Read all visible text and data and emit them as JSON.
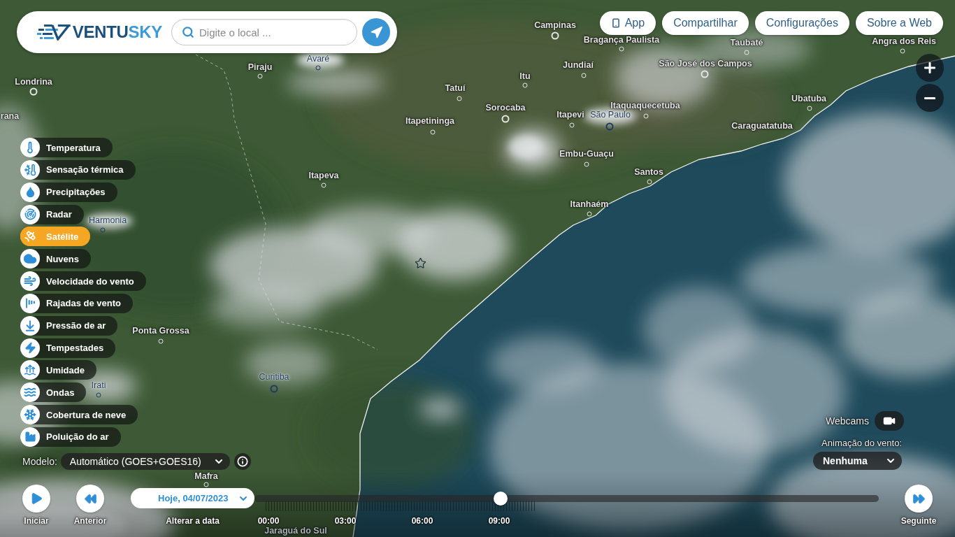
{
  "header": {
    "logo": {
      "text": "VENTU",
      "text_accent": "SKY"
    },
    "search": {
      "placeholder": "Digite o local ..."
    }
  },
  "nav_buttons": [
    {
      "label": "App",
      "kind": "icon"
    },
    {
      "label": "Compartilhar",
      "kind": "text"
    },
    {
      "label": "Configurações",
      "kind": "text"
    },
    {
      "label": "Sobre a Web",
      "kind": "text"
    }
  ],
  "map": {
    "places": [
      {
        "name": "Campinas",
        "color": "#e4e4e4"
      },
      {
        "name": "Bragança Paulista",
        "color": "#e4e4e4"
      },
      {
        "name": "Taubaté",
        "color": "#e4e4e4"
      },
      {
        "name": "Angra dos Reis",
        "color": "#e4e4e4"
      },
      {
        "name": "Avaré",
        "color": "#1f3a5f"
      },
      {
        "name": "Piraju",
        "color": "#e4e4e4"
      },
      {
        "name": "Jundiaí",
        "color": "#e4e4e4"
      },
      {
        "name": "São José dos Campos",
        "color": "#e4e4e4"
      },
      {
        "name": "Itu",
        "color": "#e4e4e4"
      },
      {
        "name": "Londrina",
        "color": "#e4e4e4"
      },
      {
        "name": "Tatuí",
        "color": "#e4e4e4"
      },
      {
        "name": "Ubatuba",
        "color": "#e4e4e4"
      },
      {
        "name": "Sorocaba",
        "color": "#e4e4e4"
      },
      {
        "name": "Itaquaquecetuba",
        "color": "#e4e4e4"
      },
      {
        "name": "rana",
        "color": "#e4e4e4"
      },
      {
        "name": "Itapevi",
        "color": "#e4e4e4"
      },
      {
        "name": "São Paulo",
        "color": "#1f3a5f"
      },
      {
        "name": "Itapetininga",
        "color": "#e4e4e4"
      },
      {
        "name": "Caraguatatuba",
        "color": "#e4e4e4"
      },
      {
        "name": "Embu-Guaçu",
        "color": "#e4e4e4"
      },
      {
        "name": "Santos",
        "color": "#e4e4e4"
      },
      {
        "name": "Itapeva",
        "color": "#e4e4e4"
      },
      {
        "name": "Itanhaém",
        "color": "#e4e4e4"
      },
      {
        "name": "Harmonia",
        "color": "#1f3a5f"
      },
      {
        "name": "Ponta Grossa",
        "color": "#e4e4e4"
      },
      {
        "name": "Curitiba",
        "color": "#1f3a5f"
      },
      {
        "name": "Irati",
        "color": "#1f3a5f"
      },
      {
        "name": "Mafra",
        "color": "#e4e4e4"
      },
      {
        "name": "Jaraguá do Sul",
        "color": "#aeb4ba"
      }
    ]
  },
  "layers": [
    {
      "label": "Temperatura",
      "selected": false
    },
    {
      "label": "Sensação térmica",
      "selected": false
    },
    {
      "label": "Precipitações",
      "selected": false
    },
    {
      "label": "Radar",
      "selected": false
    },
    {
      "label": "Satélite",
      "selected": true
    },
    {
      "label": "Nuvens",
      "selected": false
    },
    {
      "label": "Velocidade do vento",
      "selected": false
    },
    {
      "label": "Rajadas de vento",
      "selected": false
    },
    {
      "label": "Pressão de ar",
      "selected": false
    },
    {
      "label": "Tempestades",
      "selected": false
    },
    {
      "label": "Umidade",
      "selected": false
    },
    {
      "label": "Ondas",
      "selected": false
    },
    {
      "label": "Cobertura de neve",
      "selected": false
    },
    {
      "label": "Poluição do ar",
      "selected": false
    }
  ],
  "model": {
    "label": "Modelo:",
    "value": "Automático (GOES+GOES16)"
  },
  "webcams": {
    "label": "Webcams"
  },
  "wind_animation": {
    "label": "Animação do vento:",
    "value": "Nenhuma"
  },
  "timeline": {
    "controls": [
      {
        "kind": "play",
        "label": "Iniciar"
      },
      {
        "kind": "previous",
        "label": "Anterior"
      }
    ],
    "date": "Hoje, 04/07/2023",
    "date_label": "Alterar a data",
    "level": 0.394,
    "hours": [
      "00:00",
      "03:00",
      "06:00",
      "09:00"
    ],
    "next": {
      "label": "Seguinte"
    }
  }
}
